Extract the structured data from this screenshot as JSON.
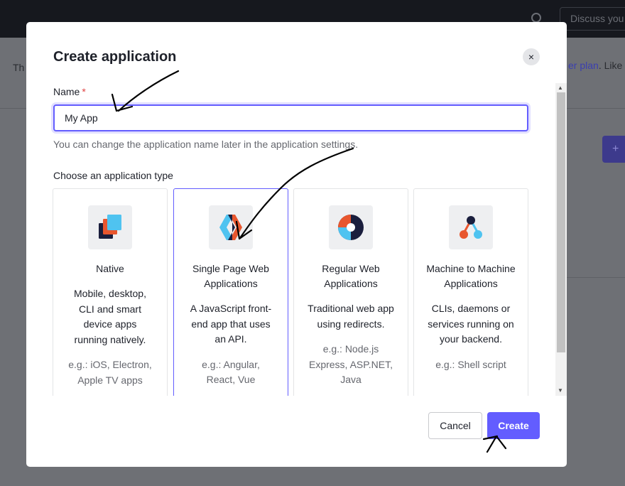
{
  "background": {
    "discuss_placeholder": "Discuss you",
    "text_left": "Th se",
    "text_right_link": "er plan",
    "text_right_after": ". Like",
    "plus_label": "+"
  },
  "modal": {
    "title": "Create application",
    "close_label": "×",
    "name_label": "Name",
    "required_mark": "*",
    "name_value": "My App",
    "name_hint": "You can change the application name later in the application settings.",
    "type_heading": "Choose an application type",
    "cards": [
      {
        "icon": "native-app-icon",
        "title": "Native",
        "description": "Mobile, desktop, CLI and smart device apps running natively.",
        "example": "e.g.: iOS, Electron, Apple TV apps",
        "selected": false
      },
      {
        "icon": "spa-icon",
        "title": "Single Page Web Applications",
        "description": "A JavaScript front-end app that uses an API.",
        "example": "e.g.: Angular, React, Vue",
        "selected": true
      },
      {
        "icon": "regular-web-app-icon",
        "title": "Regular Web Applications",
        "description": "Traditional web app using redirects.",
        "example": "e.g.: Node.js Express, ASP.NET, Java",
        "selected": false
      },
      {
        "icon": "m2m-icon",
        "title": "Machine to Machine Applications",
        "description": "CLIs, daemons or services running on your backend.",
        "example": "e.g.: Shell script",
        "selected": false
      }
    ],
    "cancel_label": "Cancel",
    "create_label": "Create"
  },
  "colors": {
    "accent": "#635dff",
    "overlay": "#6e7075",
    "required": "#e04242"
  }
}
